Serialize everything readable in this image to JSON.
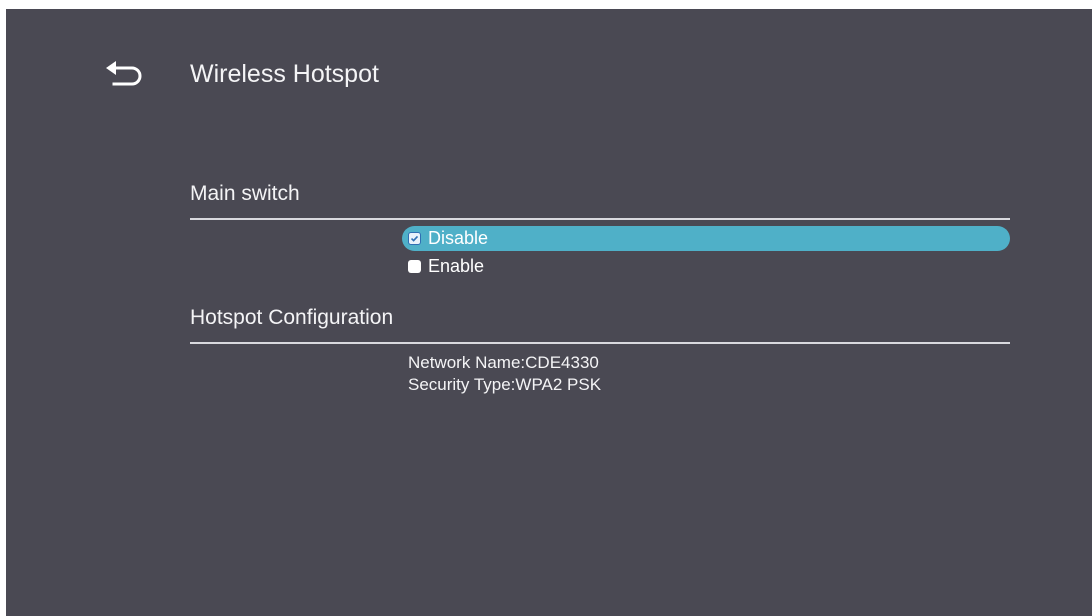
{
  "header": {
    "title": "Wireless Hotspot",
    "back_icon": "back-arrow-icon"
  },
  "main_switch": {
    "title": "Main switch",
    "options": [
      {
        "label": "Disable",
        "checked": true,
        "selected": true
      },
      {
        "label": "Enable",
        "checked": false,
        "selected": false
      }
    ]
  },
  "hotspot_config": {
    "title": "Hotspot Configuration",
    "network_name": "Network Name:CDE4330",
    "security_type": "Security Type:WPA2 PSK"
  },
  "colors": {
    "background": "#4a4953",
    "highlight": "#4fb0c8",
    "text": "#f4f4f6"
  }
}
